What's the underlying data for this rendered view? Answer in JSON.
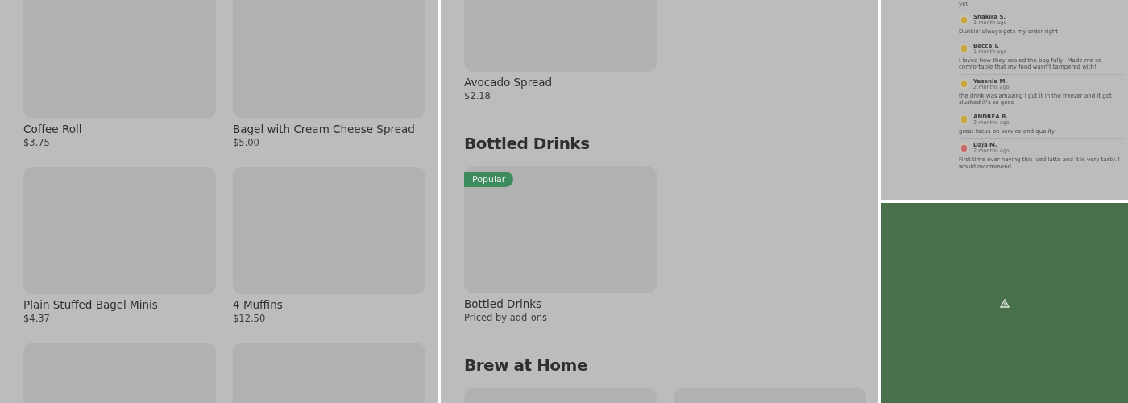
{
  "left_panel": {
    "items": [
      {
        "kind": "product",
        "title": "Coffee Roll",
        "price": "$3.75"
      },
      {
        "kind": "product",
        "title": "Bagel with Cream Cheese Spread",
        "price": "$5.00"
      },
      {
        "kind": "product",
        "title": "Plain Stuffed Bagel Minis",
        "price": "$4.37"
      },
      {
        "kind": "product",
        "title": "4 Muffins",
        "price": "$12.50"
      },
      {
        "kind": "image"
      },
      {
        "kind": "image"
      }
    ]
  },
  "middle_panel": {
    "sections": [
      {
        "items": [
          {
            "kind": "product",
            "title": "Avocado Spread",
            "price": "$2.18"
          }
        ]
      },
      {
        "heading": "Bottled Drinks",
        "items": [
          {
            "kind": "product",
            "badge": "Popular",
            "title": "Bottled Drinks",
            "price": "Priced by add-ons"
          }
        ]
      },
      {
        "heading": "Brew at Home",
        "items": [
          {
            "kind": "image"
          },
          {
            "kind": "image"
          }
        ]
      }
    ]
  },
  "reviews_panel": {
    "cut_text": "yet",
    "reviews": [
      {
        "name": "Shakira S.",
        "time": "1 month ago",
        "text": "Dunkin' always gets my order right",
        "color": "#c9a640"
      },
      {
        "name": "Becca T.",
        "time": "1 month ago",
        "text": "I loved how they sealed the bag fully! Made me so comfortable that my food wasn't tampered with!",
        "color": "#c9a640"
      },
      {
        "name": "Yasenia M.",
        "time": "2 months ago",
        "text": "the drink was amazing I put it in the freezer and it got slushed it's so good",
        "color": "#c9a640"
      },
      {
        "name": "ANDREA B.",
        "time": "2 months ago",
        "text": "great focus on service and quality",
        "color": "#c9a640"
      },
      {
        "name": "Daja M.",
        "time": "2 months ago",
        "text": "First time ever having this iced latte and it is very tasty. I would recommend",
        "color": "#c86a6a"
      }
    ]
  },
  "map_panel": {
    "kind": "warning"
  }
}
